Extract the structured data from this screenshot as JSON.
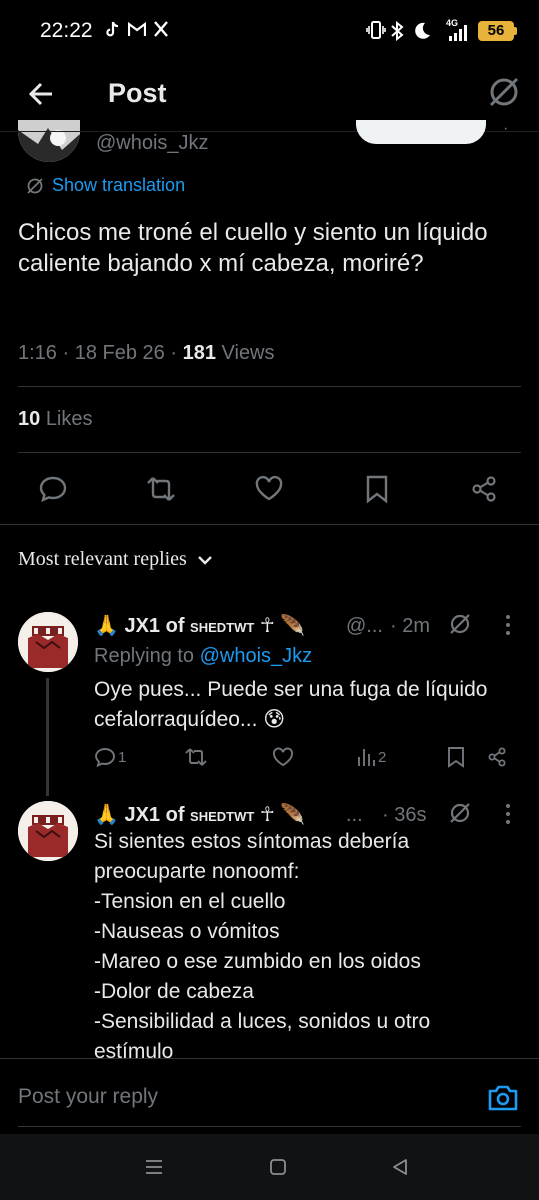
{
  "status_bar": {
    "time": "22:22",
    "battery": "56",
    "network": "4G",
    "left_icons": [
      "tiktok-icon",
      "gmail-icon",
      "x-icon"
    ],
    "right_icons": [
      "vibrate-icon",
      "bluetooth-icon",
      "moon-icon",
      "signal-icon",
      "battery-icon"
    ]
  },
  "header": {
    "title": "Post"
  },
  "tweet": {
    "handle": "@whois_Jkz",
    "show_translation": "Show translation",
    "text": "Chicos me troné el cuello y siento un líquido caliente bajando x mí cabeza, moriré?",
    "time": "1:16",
    "date": "18 Feb 26",
    "views_count": "181",
    "views_label": "Views",
    "likes_count": "10",
    "likes_label": "Likes"
  },
  "sort": {
    "label": "Most relevant replies"
  },
  "replies": [
    {
      "name_prefix": "🙏 JX1 of ",
      "name_smallcaps": "shedtwt",
      "name_suffix": " ☥ 🪶",
      "handle": "@...",
      "time": "· 2m",
      "replying_to_prefix": "Replying to ",
      "replying_to_handle": "@whois_Jkz",
      "text": "Oye pues... Puede ser una fuga de líquido cefalorraquídeo... 😰",
      "reply_count": "1",
      "retweet_count": "",
      "views_count": "2"
    },
    {
      "name_prefix": "🙏 JX1 of ",
      "name_smallcaps": "shedtwt",
      "name_suffix": " ☥ 🪶",
      "handle": "...",
      "time": "· 36s",
      "lines": [
        "Si sientes estos síntomas debería",
        "preocuparte nonoomf:",
        "-Tension en el cuello",
        "-Nauseas o vómitos",
        "-Mareo o ese zumbido en los oidos",
        "-Dolor de cabeza",
        "-Sensibilidad a luces, sonidos u otro",
        "estímulo"
      ]
    }
  ],
  "composer": {
    "placeholder": "Post your reply"
  },
  "colors": {
    "accent": "#1d9bf0",
    "muted": "#71767b",
    "text": "#e7e9ea",
    "background": "#000000",
    "battery": "#e8b33a"
  }
}
